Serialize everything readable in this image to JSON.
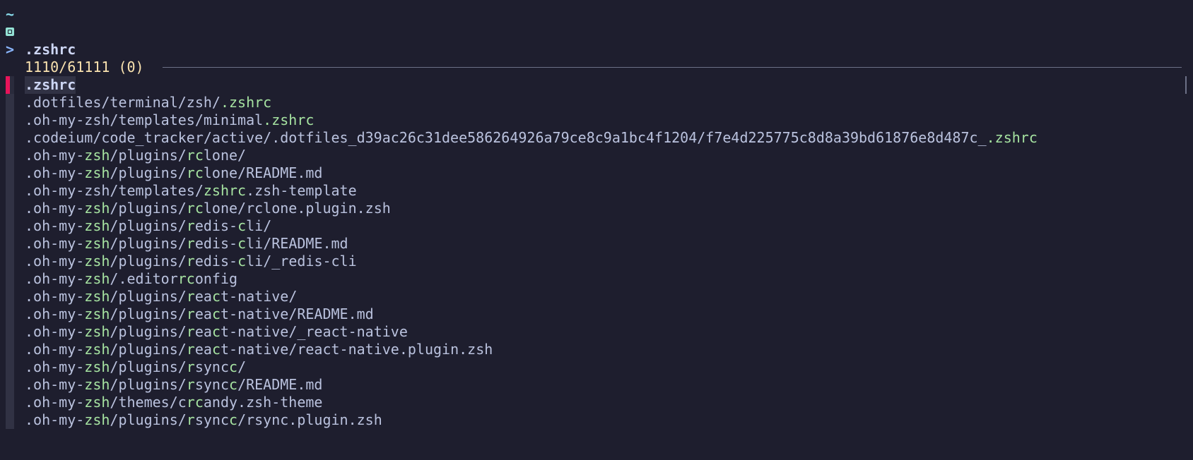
{
  "prompt": {
    "cwd": "~",
    "arrow": ">",
    "query": ".zshrc"
  },
  "info": {
    "count": "1110/61111 (0)"
  },
  "colors": {
    "background": "#1e1e2e",
    "match": "#a6e3a1",
    "pointer": "#e8145a",
    "info": "#f9e2af"
  },
  "results": [
    [
      {
        "t": ".zshrc",
        "m": false
      }
    ],
    [
      {
        "t": ".dotfiles/terminal/zsh/",
        "m": false
      },
      {
        "t": ".zshrc",
        "m": true
      }
    ],
    [
      {
        "t": ".oh-my-zsh/templates/minimal",
        "m": false
      },
      {
        "t": ".zshrc",
        "m": true
      }
    ],
    [
      {
        "t": ".codeium/code_tracker/active/.dotfiles_d39ac26c31dee586264926a79ce8c9a1bc4f1204/f7e4d225775c8d8a39bd61876e8d487c_",
        "m": false
      },
      {
        "t": ".zshrc",
        "m": true
      }
    ],
    [
      {
        "t": ".oh-my-",
        "m": false
      },
      {
        "t": "zsh",
        "m": true
      },
      {
        "t": "/plugins/",
        "m": false
      },
      {
        "t": "rc",
        "m": true
      },
      {
        "t": "lone/",
        "m": false
      }
    ],
    [
      {
        "t": ".oh-my-",
        "m": false
      },
      {
        "t": "zsh",
        "m": true
      },
      {
        "t": "/plugins/",
        "m": false
      },
      {
        "t": "rc",
        "m": true
      },
      {
        "t": "lone/README.md",
        "m": false
      }
    ],
    [
      {
        "t": ".oh-my-zsh/templates/",
        "m": false
      },
      {
        "t": "zshrc",
        "m": true
      },
      {
        "t": ".zsh-template",
        "m": false
      }
    ],
    [
      {
        "t": ".oh-my-",
        "m": false
      },
      {
        "t": "zsh",
        "m": true
      },
      {
        "t": "/plugins/",
        "m": false
      },
      {
        "t": "rc",
        "m": true
      },
      {
        "t": "lone/rclone.plugin.zsh",
        "m": false
      }
    ],
    [
      {
        "t": ".oh-my-",
        "m": false
      },
      {
        "t": "zsh",
        "m": true
      },
      {
        "t": "/plugins/",
        "m": false
      },
      {
        "t": "r",
        "m": true
      },
      {
        "t": "edis-",
        "m": false
      },
      {
        "t": "c",
        "m": true
      },
      {
        "t": "li/",
        "m": false
      }
    ],
    [
      {
        "t": ".oh-my-",
        "m": false
      },
      {
        "t": "zsh",
        "m": true
      },
      {
        "t": "/plugins/",
        "m": false
      },
      {
        "t": "r",
        "m": true
      },
      {
        "t": "edis-",
        "m": false
      },
      {
        "t": "c",
        "m": true
      },
      {
        "t": "li/README.md",
        "m": false
      }
    ],
    [
      {
        "t": ".oh-my-",
        "m": false
      },
      {
        "t": "zsh",
        "m": true
      },
      {
        "t": "/plugins/",
        "m": false
      },
      {
        "t": "r",
        "m": true
      },
      {
        "t": "edis-",
        "m": false
      },
      {
        "t": "c",
        "m": true
      },
      {
        "t": "li/_redis-cli",
        "m": false
      }
    ],
    [
      {
        "t": ".oh-my-",
        "m": false
      },
      {
        "t": "zsh",
        "m": true
      },
      {
        "t": "/.editor",
        "m": false
      },
      {
        "t": "rc",
        "m": true
      },
      {
        "t": "onfig",
        "m": false
      }
    ],
    [
      {
        "t": ".oh-my-",
        "m": false
      },
      {
        "t": "zsh",
        "m": true
      },
      {
        "t": "/plugins/",
        "m": false
      },
      {
        "t": "r",
        "m": true
      },
      {
        "t": "ea",
        "m": false
      },
      {
        "t": "c",
        "m": true
      },
      {
        "t": "t-native/",
        "m": false
      }
    ],
    [
      {
        "t": ".oh-my-",
        "m": false
      },
      {
        "t": "zsh",
        "m": true
      },
      {
        "t": "/plugins/",
        "m": false
      },
      {
        "t": "r",
        "m": true
      },
      {
        "t": "ea",
        "m": false
      },
      {
        "t": "c",
        "m": true
      },
      {
        "t": "t-native/README.md",
        "m": false
      }
    ],
    [
      {
        "t": ".oh-my-",
        "m": false
      },
      {
        "t": "zsh",
        "m": true
      },
      {
        "t": "/plugins/",
        "m": false
      },
      {
        "t": "r",
        "m": true
      },
      {
        "t": "ea",
        "m": false
      },
      {
        "t": "c",
        "m": true
      },
      {
        "t": "t-native/_react-native",
        "m": false
      }
    ],
    [
      {
        "t": ".oh-my-",
        "m": false
      },
      {
        "t": "zsh",
        "m": true
      },
      {
        "t": "/plugins/",
        "m": false
      },
      {
        "t": "r",
        "m": true
      },
      {
        "t": "ea",
        "m": false
      },
      {
        "t": "c",
        "m": true
      },
      {
        "t": "t-native/react-native.plugin.zsh",
        "m": false
      }
    ],
    [
      {
        "t": ".oh-my-",
        "m": false
      },
      {
        "t": "zsh",
        "m": true
      },
      {
        "t": "/plugins/",
        "m": false
      },
      {
        "t": "r",
        "m": true
      },
      {
        "t": "sync",
        "m": false
      },
      {
        "t": "c",
        "m": true
      },
      {
        "t": "/",
        "m": false
      }
    ],
    [
      {
        "t": ".oh-my-",
        "m": false
      },
      {
        "t": "zsh",
        "m": true
      },
      {
        "t": "/plugins/",
        "m": false
      },
      {
        "t": "r",
        "m": true
      },
      {
        "t": "sync",
        "m": false
      },
      {
        "t": "c",
        "m": true
      },
      {
        "t": "/README.md",
        "m": false
      }
    ],
    [
      {
        "t": ".oh-my-",
        "m": false
      },
      {
        "t": "zsh",
        "m": true
      },
      {
        "t": "/themes/c",
        "m": false
      },
      {
        "t": "rc",
        "m": true
      },
      {
        "t": "andy.zsh-theme",
        "m": false
      }
    ],
    [
      {
        "t": ".oh-my-",
        "m": false
      },
      {
        "t": "zsh",
        "m": true
      },
      {
        "t": "/plugins/",
        "m": false
      },
      {
        "t": "r",
        "m": true
      },
      {
        "t": "sync",
        "m": false
      },
      {
        "t": "c",
        "m": true
      },
      {
        "t": "/rsync.plugin.zsh",
        "m": false
      }
    ]
  ]
}
